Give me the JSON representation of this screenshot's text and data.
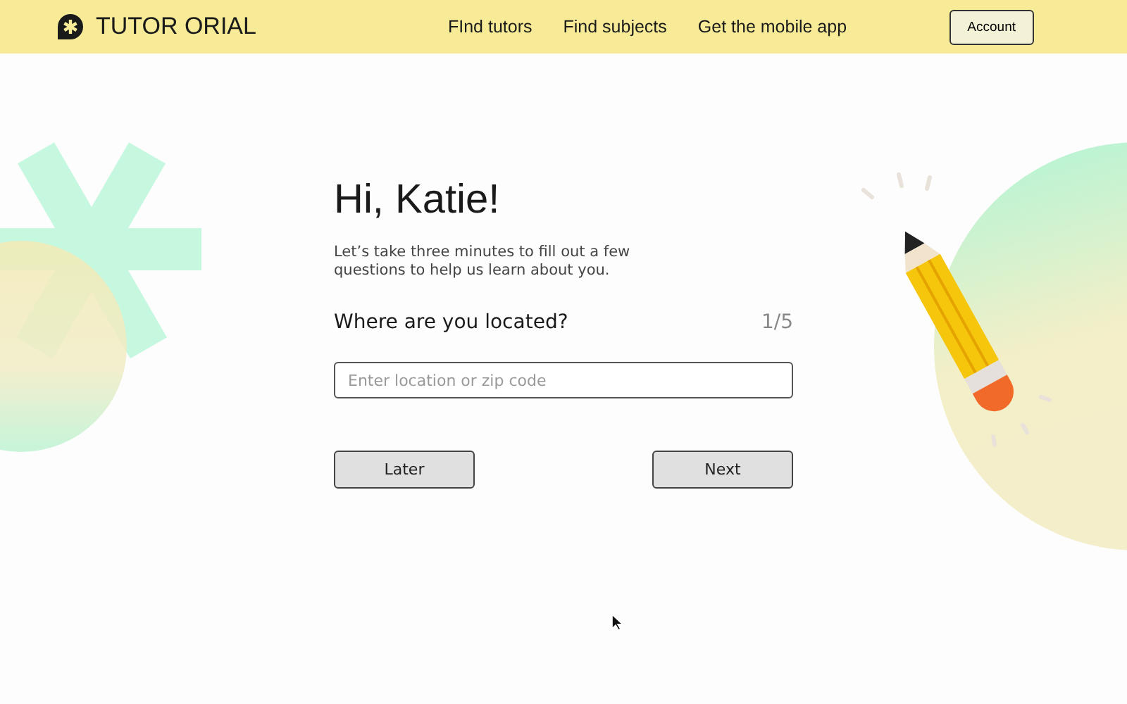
{
  "brand": {
    "name": "TUTOR ORIAL"
  },
  "nav": [
    "FInd tutors",
    "Find subjects",
    "Get the mobile app"
  ],
  "account_button": "Account",
  "greeting": "Hi, Katie!",
  "intro": "Let’s take three minutes to fill out a few questions to help us learn about you.",
  "question": {
    "label": "Where are you located?",
    "progress": "1/5",
    "placeholder": "Enter location or zip code"
  },
  "buttons": [
    "Later",
    "Next"
  ]
}
